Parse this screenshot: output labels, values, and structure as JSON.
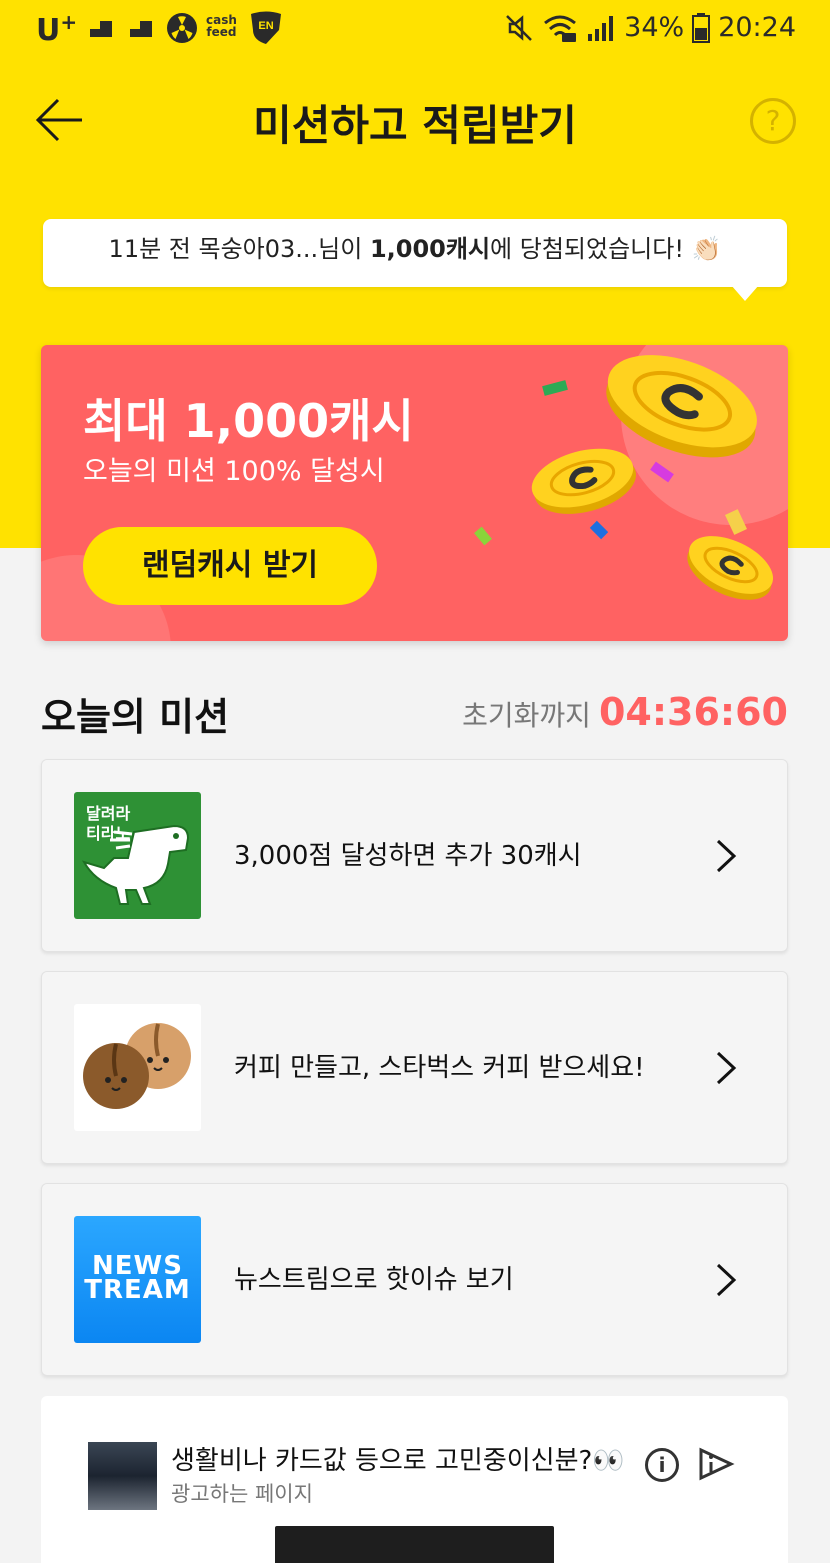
{
  "status_bar": {
    "carrier": "U",
    "carrier_sup": "+",
    "cashfeed_top": "cash",
    "cashfeed_bottom": "feed",
    "en_badge": "EN",
    "battery": "34%",
    "time": "20:24",
    "icons": [
      "mute-icon",
      "wifi-icon",
      "signal-icon",
      "battery-icon"
    ]
  },
  "header": {
    "title": "미션하고 적립받기",
    "help": "?"
  },
  "notice": {
    "prefix": "11분 전 목숭아03...님이 ",
    "highlight": "1,000캐시",
    "suffix": "에 당첨되었습니다! 👏🏻"
  },
  "promo": {
    "title": "최대 1,000캐시",
    "subtitle": "오늘의 미션 100% 달성시",
    "button": "랜덤캐시 받기"
  },
  "missions_section": {
    "title": "오늘의 미션",
    "timer_label": "초기화까지",
    "timer_value": "04:36:60"
  },
  "missions": [
    {
      "thumb_label_line1": "달려라",
      "thumb_label_line2": "티라노",
      "text": "3,000점 달성하면 추가 30캐시"
    },
    {
      "text": "커피 만들고, 스타벅스 커피 받으세요!"
    },
    {
      "thumb_line1": "NEWS",
      "thumb_line2": "TREAM",
      "text": "뉴스트림으로 핫이슈 보기"
    }
  ],
  "ad": {
    "title": "생활비나 카드값 등으로 고민중이신분?👀",
    "subtitle": "광고하는 페이지",
    "info": "i"
  },
  "colors": {
    "brand_yellow": "#ffe200",
    "promo_red": "#ff6262",
    "timer_red": "#ff6262"
  }
}
